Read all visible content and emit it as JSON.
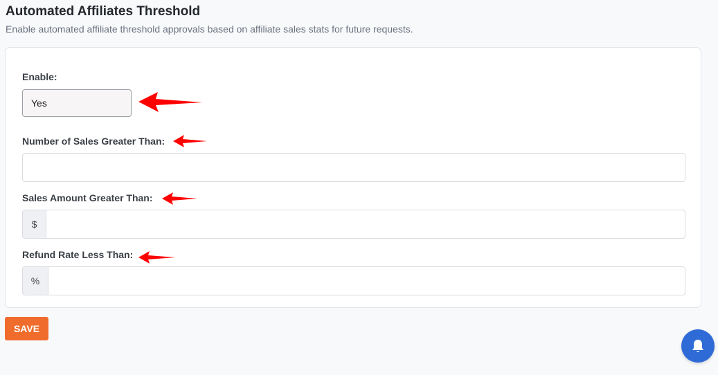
{
  "header": {
    "title": "Automated Affiliates Threshold",
    "subtitle": "Enable automated affiliate threshold approvals based on affiliate sales stats for future requests."
  },
  "form": {
    "enable": {
      "label": "Enable:",
      "value": "Yes"
    },
    "sales_count": {
      "label": "Number of Sales Greater Than:",
      "value": ""
    },
    "sales_amount": {
      "label": "Sales Amount Greater Than:",
      "prefix": "$",
      "value": ""
    },
    "refund_rate": {
      "label": "Refund Rate Less Than:",
      "prefix": "%",
      "value": ""
    }
  },
  "actions": {
    "save_label": "SAVE"
  },
  "icons": {
    "annotation_arrow": "red-arrow-icon",
    "notification": "bell-icon"
  },
  "colors": {
    "accent": "#ef6c2c",
    "fab": "#2f6bd6",
    "annotation": "#ff0000"
  }
}
